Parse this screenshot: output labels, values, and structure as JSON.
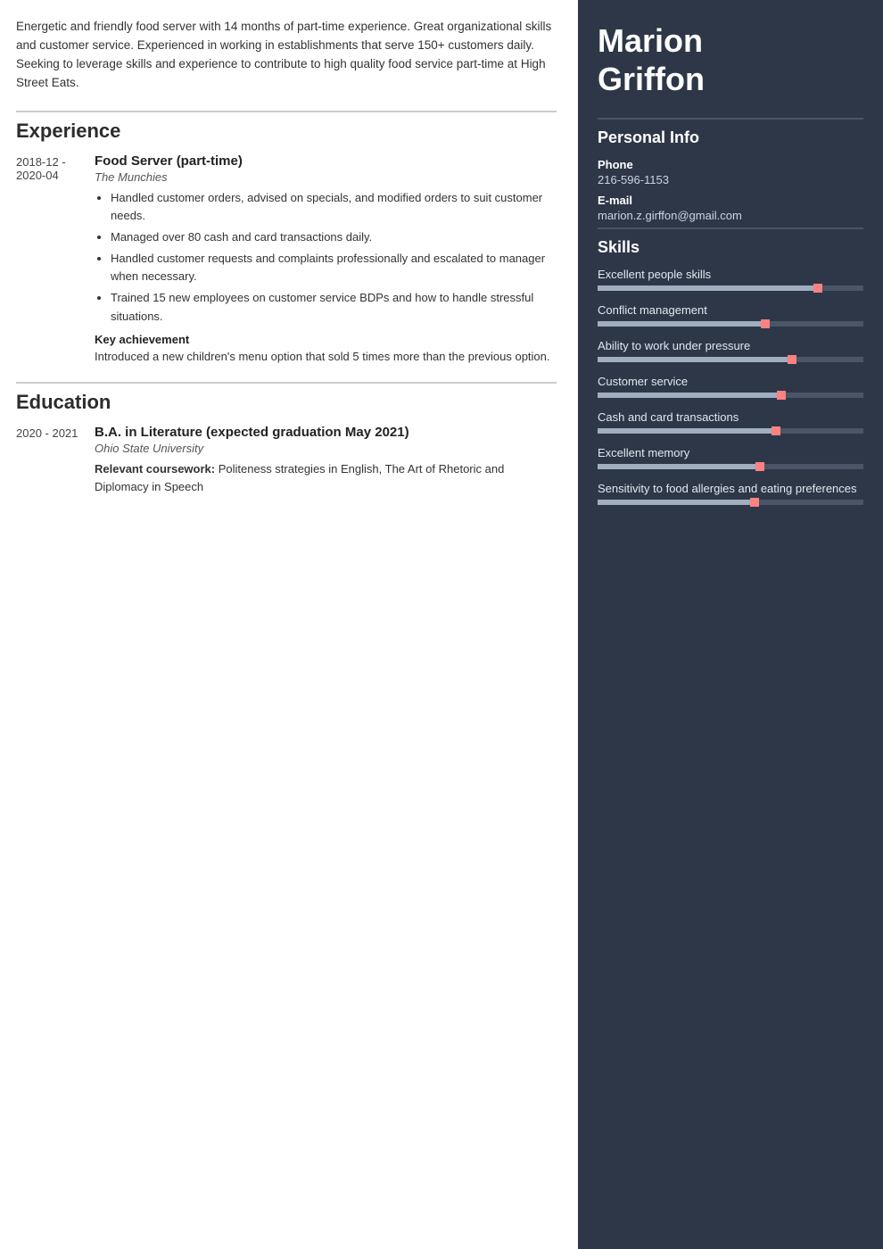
{
  "summary": "Energetic and friendly food server with 14 months of part-time experience. Great organizational skills and customer service. Experienced in working in establishments that serve 150+ customers daily. Seeking to leverage skills and experience to contribute to high quality food service part-time at High Street Eats.",
  "sections": {
    "experience_title": "Experience",
    "education_title": "Education"
  },
  "experience": [
    {
      "date": "2018-12 - 2020-04",
      "title": "Food Server (part-time)",
      "company": "The Munchies",
      "bullets": [
        "Handled customer orders, advised on specials, and modified orders to suit customer needs.",
        "Managed over 80 cash and card transactions daily.",
        "Handled customer requests and complaints professionally and escalated to manager when necessary.",
        "Trained 15 new employees on customer service BDPs and how to handle stressful situations."
      ],
      "key_achievement_label": "Key achievement",
      "key_achievement_text": "Introduced a new children's menu option that sold 5 times more than the previous option."
    }
  ],
  "education": [
    {
      "date": "2020 - 2021",
      "title": "B.A. in Literature (expected graduation May 2021)",
      "company": "Ohio State University",
      "coursework_label": "Relevant coursework:",
      "coursework_text": "Politeness strategies in English, The Art of Rhetoric and Diplomacy in Speech"
    }
  ],
  "sidebar": {
    "name_line1": "Marion",
    "name_line2": "Griffon",
    "personal_info_title": "Personal Info",
    "phone_label": "Phone",
    "phone_value": "216-596-1153",
    "email_label": "E-mail",
    "email_value": "marion.z.girffon@gmail.com",
    "skills_title": "Skills",
    "skills": [
      {
        "name": "Excellent people skills",
        "fill_pct": 82,
        "dot_pct": 82
      },
      {
        "name": "Conflict management",
        "fill_pct": 62,
        "dot_pct": 62
      },
      {
        "name": "Ability to work under pressure",
        "fill_pct": 72,
        "dot_pct": 72
      },
      {
        "name": "Customer service",
        "fill_pct": 68,
        "dot_pct": 68
      },
      {
        "name": "Cash and card transactions",
        "fill_pct": 66,
        "dot_pct": 66
      },
      {
        "name": "Excellent memory",
        "fill_pct": 60,
        "dot_pct": 60
      },
      {
        "name": "Sensitivity to food allergies and eating preferences",
        "fill_pct": 58,
        "dot_pct": 58
      }
    ]
  }
}
